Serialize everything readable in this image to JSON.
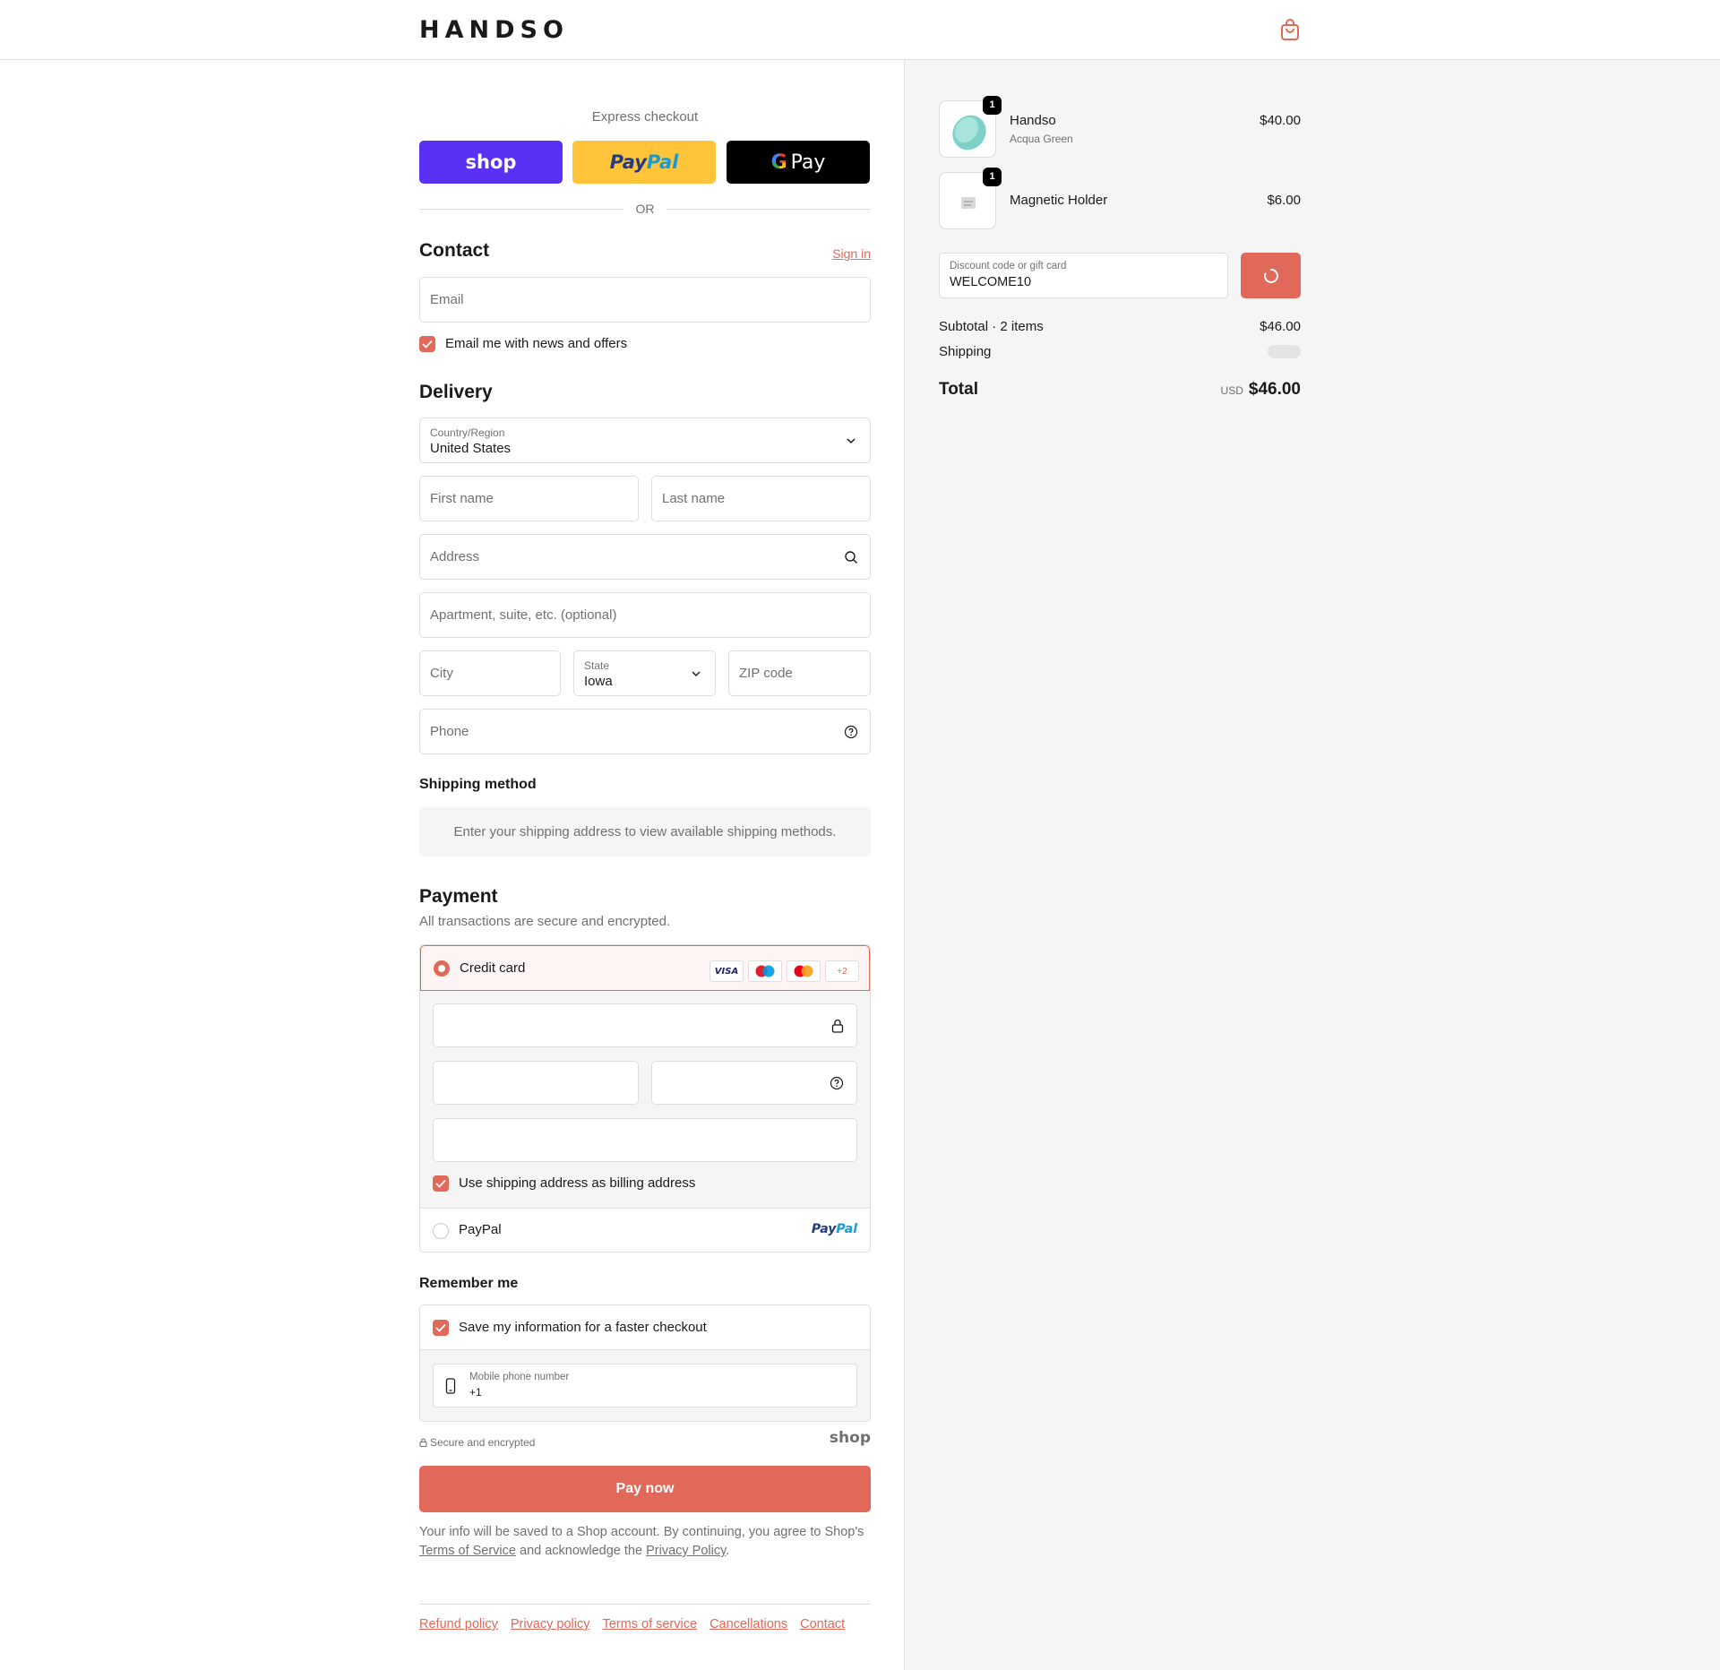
{
  "brand": {
    "name": "HANDSO",
    "accent": "#e0695a"
  },
  "express": {
    "label": "Express checkout",
    "shop_label": "shop",
    "paypal_a": "Pay",
    "paypal_b": "Pal",
    "gpay_g": "G",
    "gpay_label": "Pay",
    "or": "OR"
  },
  "contact": {
    "title": "Contact",
    "sign_in": "Sign in",
    "email_placeholder": "Email",
    "news_label": "Email me with news and offers"
  },
  "delivery": {
    "title": "Delivery",
    "country_label": "Country/Region",
    "country_value": "United States",
    "first_name": "First name",
    "last_name": "Last name",
    "address": "Address",
    "apartment": "Apartment, suite, etc. (optional)",
    "city": "City",
    "state_label": "State",
    "state_value": "Iowa",
    "zip": "ZIP code",
    "phone": "Phone"
  },
  "shipping": {
    "title": "Shipping method",
    "message": "Enter your shipping address to view available shipping methods."
  },
  "payment": {
    "title": "Payment",
    "subtitle": "All transactions are secure and encrypted.",
    "credit_card": "Credit card",
    "badges": {
      "visa": "VISA",
      "more": "+2"
    },
    "billing_label": "Use shipping address as billing address",
    "paypal_label": "PayPal",
    "paypal_logo_a": "Pay",
    "paypal_logo_b": "Pal"
  },
  "remember": {
    "title": "Remember me",
    "save_label": "Save my information for a faster checkout",
    "mobile_label": "Mobile phone number",
    "mobile_value": "+1",
    "secure": "Secure and encrypted",
    "shop_logo": "shop"
  },
  "pay_now": "Pay now",
  "legal": {
    "part1": "Your info will be saved to a Shop account. By continuing, you agree to Shop's ",
    "terms": "Terms of Service",
    "part2": " and acknowledge the ",
    "privacy": "Privacy Policy",
    "part3": "."
  },
  "footer": [
    "Refund policy",
    "Privacy policy",
    "Terms of service",
    "Cancellations",
    "Contact"
  ],
  "summary": {
    "items": [
      {
        "qty": "1",
        "name": "Handso",
        "variant": "Acqua Green",
        "price": "$40.00"
      },
      {
        "qty": "1",
        "name": "Magnetic Holder",
        "variant": "",
        "price": "$6.00"
      }
    ],
    "discount_label": "Discount code or gift card",
    "discount_value": "WELCOME10",
    "subtotal_label": "Subtotal · 2 items",
    "subtotal_value": "$46.00",
    "shipping_label": "Shipping",
    "total_label": "Total",
    "currency": "USD",
    "total_value": "$46.00"
  }
}
